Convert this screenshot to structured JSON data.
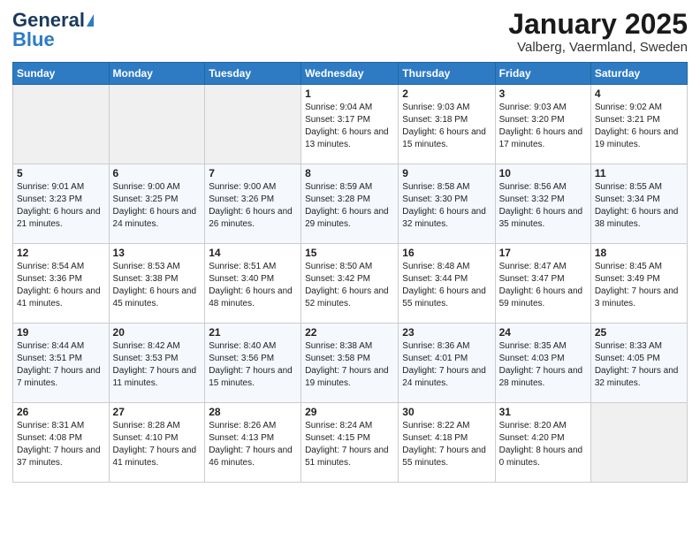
{
  "header": {
    "logo_general": "General",
    "logo_blue": "Blue",
    "month_title": "January 2025",
    "subtitle": "Valberg, Vaermland, Sweden"
  },
  "weekdays": [
    "Sunday",
    "Monday",
    "Tuesday",
    "Wednesday",
    "Thursday",
    "Friday",
    "Saturday"
  ],
  "weeks": [
    [
      {
        "day": "",
        "sunrise": "",
        "sunset": "",
        "daylight": ""
      },
      {
        "day": "",
        "sunrise": "",
        "sunset": "",
        "daylight": ""
      },
      {
        "day": "",
        "sunrise": "",
        "sunset": "",
        "daylight": ""
      },
      {
        "day": "1",
        "sunrise": "Sunrise: 9:04 AM",
        "sunset": "Sunset: 3:17 PM",
        "daylight": "Daylight: 6 hours and 13 minutes."
      },
      {
        "day": "2",
        "sunrise": "Sunrise: 9:03 AM",
        "sunset": "Sunset: 3:18 PM",
        "daylight": "Daylight: 6 hours and 15 minutes."
      },
      {
        "day": "3",
        "sunrise": "Sunrise: 9:03 AM",
        "sunset": "Sunset: 3:20 PM",
        "daylight": "Daylight: 6 hours and 17 minutes."
      },
      {
        "day": "4",
        "sunrise": "Sunrise: 9:02 AM",
        "sunset": "Sunset: 3:21 PM",
        "daylight": "Daylight: 6 hours and 19 minutes."
      }
    ],
    [
      {
        "day": "5",
        "sunrise": "Sunrise: 9:01 AM",
        "sunset": "Sunset: 3:23 PM",
        "daylight": "Daylight: 6 hours and 21 minutes."
      },
      {
        "day": "6",
        "sunrise": "Sunrise: 9:00 AM",
        "sunset": "Sunset: 3:25 PM",
        "daylight": "Daylight: 6 hours and 24 minutes."
      },
      {
        "day": "7",
        "sunrise": "Sunrise: 9:00 AM",
        "sunset": "Sunset: 3:26 PM",
        "daylight": "Daylight: 6 hours and 26 minutes."
      },
      {
        "day": "8",
        "sunrise": "Sunrise: 8:59 AM",
        "sunset": "Sunset: 3:28 PM",
        "daylight": "Daylight: 6 hours and 29 minutes."
      },
      {
        "day": "9",
        "sunrise": "Sunrise: 8:58 AM",
        "sunset": "Sunset: 3:30 PM",
        "daylight": "Daylight: 6 hours and 32 minutes."
      },
      {
        "day": "10",
        "sunrise": "Sunrise: 8:56 AM",
        "sunset": "Sunset: 3:32 PM",
        "daylight": "Daylight: 6 hours and 35 minutes."
      },
      {
        "day": "11",
        "sunrise": "Sunrise: 8:55 AM",
        "sunset": "Sunset: 3:34 PM",
        "daylight": "Daylight: 6 hours and 38 minutes."
      }
    ],
    [
      {
        "day": "12",
        "sunrise": "Sunrise: 8:54 AM",
        "sunset": "Sunset: 3:36 PM",
        "daylight": "Daylight: 6 hours and 41 minutes."
      },
      {
        "day": "13",
        "sunrise": "Sunrise: 8:53 AM",
        "sunset": "Sunset: 3:38 PM",
        "daylight": "Daylight: 6 hours and 45 minutes."
      },
      {
        "day": "14",
        "sunrise": "Sunrise: 8:51 AM",
        "sunset": "Sunset: 3:40 PM",
        "daylight": "Daylight: 6 hours and 48 minutes."
      },
      {
        "day": "15",
        "sunrise": "Sunrise: 8:50 AM",
        "sunset": "Sunset: 3:42 PM",
        "daylight": "Daylight: 6 hours and 52 minutes."
      },
      {
        "day": "16",
        "sunrise": "Sunrise: 8:48 AM",
        "sunset": "Sunset: 3:44 PM",
        "daylight": "Daylight: 6 hours and 55 minutes."
      },
      {
        "day": "17",
        "sunrise": "Sunrise: 8:47 AM",
        "sunset": "Sunset: 3:47 PM",
        "daylight": "Daylight: 6 hours and 59 minutes."
      },
      {
        "day": "18",
        "sunrise": "Sunrise: 8:45 AM",
        "sunset": "Sunset: 3:49 PM",
        "daylight": "Daylight: 7 hours and 3 minutes."
      }
    ],
    [
      {
        "day": "19",
        "sunrise": "Sunrise: 8:44 AM",
        "sunset": "Sunset: 3:51 PM",
        "daylight": "Daylight: 7 hours and 7 minutes."
      },
      {
        "day": "20",
        "sunrise": "Sunrise: 8:42 AM",
        "sunset": "Sunset: 3:53 PM",
        "daylight": "Daylight: 7 hours and 11 minutes."
      },
      {
        "day": "21",
        "sunrise": "Sunrise: 8:40 AM",
        "sunset": "Sunset: 3:56 PM",
        "daylight": "Daylight: 7 hours and 15 minutes."
      },
      {
        "day": "22",
        "sunrise": "Sunrise: 8:38 AM",
        "sunset": "Sunset: 3:58 PM",
        "daylight": "Daylight: 7 hours and 19 minutes."
      },
      {
        "day": "23",
        "sunrise": "Sunrise: 8:36 AM",
        "sunset": "Sunset: 4:01 PM",
        "daylight": "Daylight: 7 hours and 24 minutes."
      },
      {
        "day": "24",
        "sunrise": "Sunrise: 8:35 AM",
        "sunset": "Sunset: 4:03 PM",
        "daylight": "Daylight: 7 hours and 28 minutes."
      },
      {
        "day": "25",
        "sunrise": "Sunrise: 8:33 AM",
        "sunset": "Sunset: 4:05 PM",
        "daylight": "Daylight: 7 hours and 32 minutes."
      }
    ],
    [
      {
        "day": "26",
        "sunrise": "Sunrise: 8:31 AM",
        "sunset": "Sunset: 4:08 PM",
        "daylight": "Daylight: 7 hours and 37 minutes."
      },
      {
        "day": "27",
        "sunrise": "Sunrise: 8:28 AM",
        "sunset": "Sunset: 4:10 PM",
        "daylight": "Daylight: 7 hours and 41 minutes."
      },
      {
        "day": "28",
        "sunrise": "Sunrise: 8:26 AM",
        "sunset": "Sunset: 4:13 PM",
        "daylight": "Daylight: 7 hours and 46 minutes."
      },
      {
        "day": "29",
        "sunrise": "Sunrise: 8:24 AM",
        "sunset": "Sunset: 4:15 PM",
        "daylight": "Daylight: 7 hours and 51 minutes."
      },
      {
        "day": "30",
        "sunrise": "Sunrise: 8:22 AM",
        "sunset": "Sunset: 4:18 PM",
        "daylight": "Daylight: 7 hours and 55 minutes."
      },
      {
        "day": "31",
        "sunrise": "Sunrise: 8:20 AM",
        "sunset": "Sunset: 4:20 PM",
        "daylight": "Daylight: 8 hours and 0 minutes."
      },
      {
        "day": "",
        "sunrise": "",
        "sunset": "",
        "daylight": ""
      }
    ]
  ]
}
